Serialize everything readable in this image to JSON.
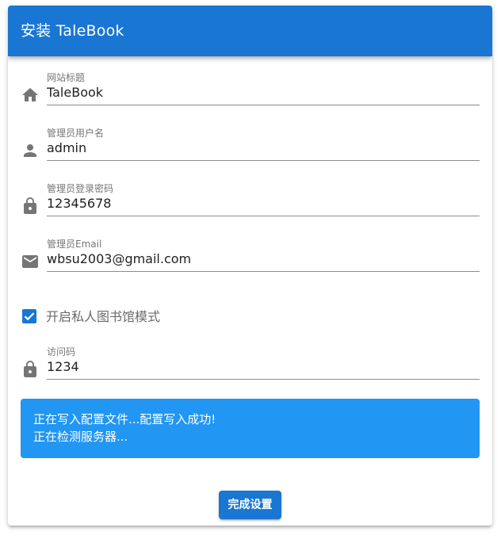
{
  "header": {
    "title": "安装 TaleBook"
  },
  "form": {
    "site_title": {
      "label": "网站标题",
      "value": "TaleBook",
      "icon": "home-icon"
    },
    "admin_username": {
      "label": "管理员用户名",
      "value": "admin",
      "icon": "person-icon"
    },
    "admin_password": {
      "label": "管理员登录密码",
      "value": "12345678",
      "icon": "lock-icon"
    },
    "admin_email": {
      "label": "管理员Email",
      "value": "wbsu2003@gmail.com",
      "icon": "email-icon"
    },
    "private_mode": {
      "label": "开启私人图书馆模式",
      "checked": true
    },
    "access_code": {
      "label": "访问码",
      "value": "1234",
      "icon": "lock-icon"
    }
  },
  "status": {
    "lines": [
      "正在写入配置文件...配置写入成功!",
      "正在检测服务器..."
    ]
  },
  "actions": {
    "submit_label": "完成设置"
  },
  "colors": {
    "primary": "#1976d2",
    "info": "#2196f3",
    "icon_gray": "#757575"
  }
}
